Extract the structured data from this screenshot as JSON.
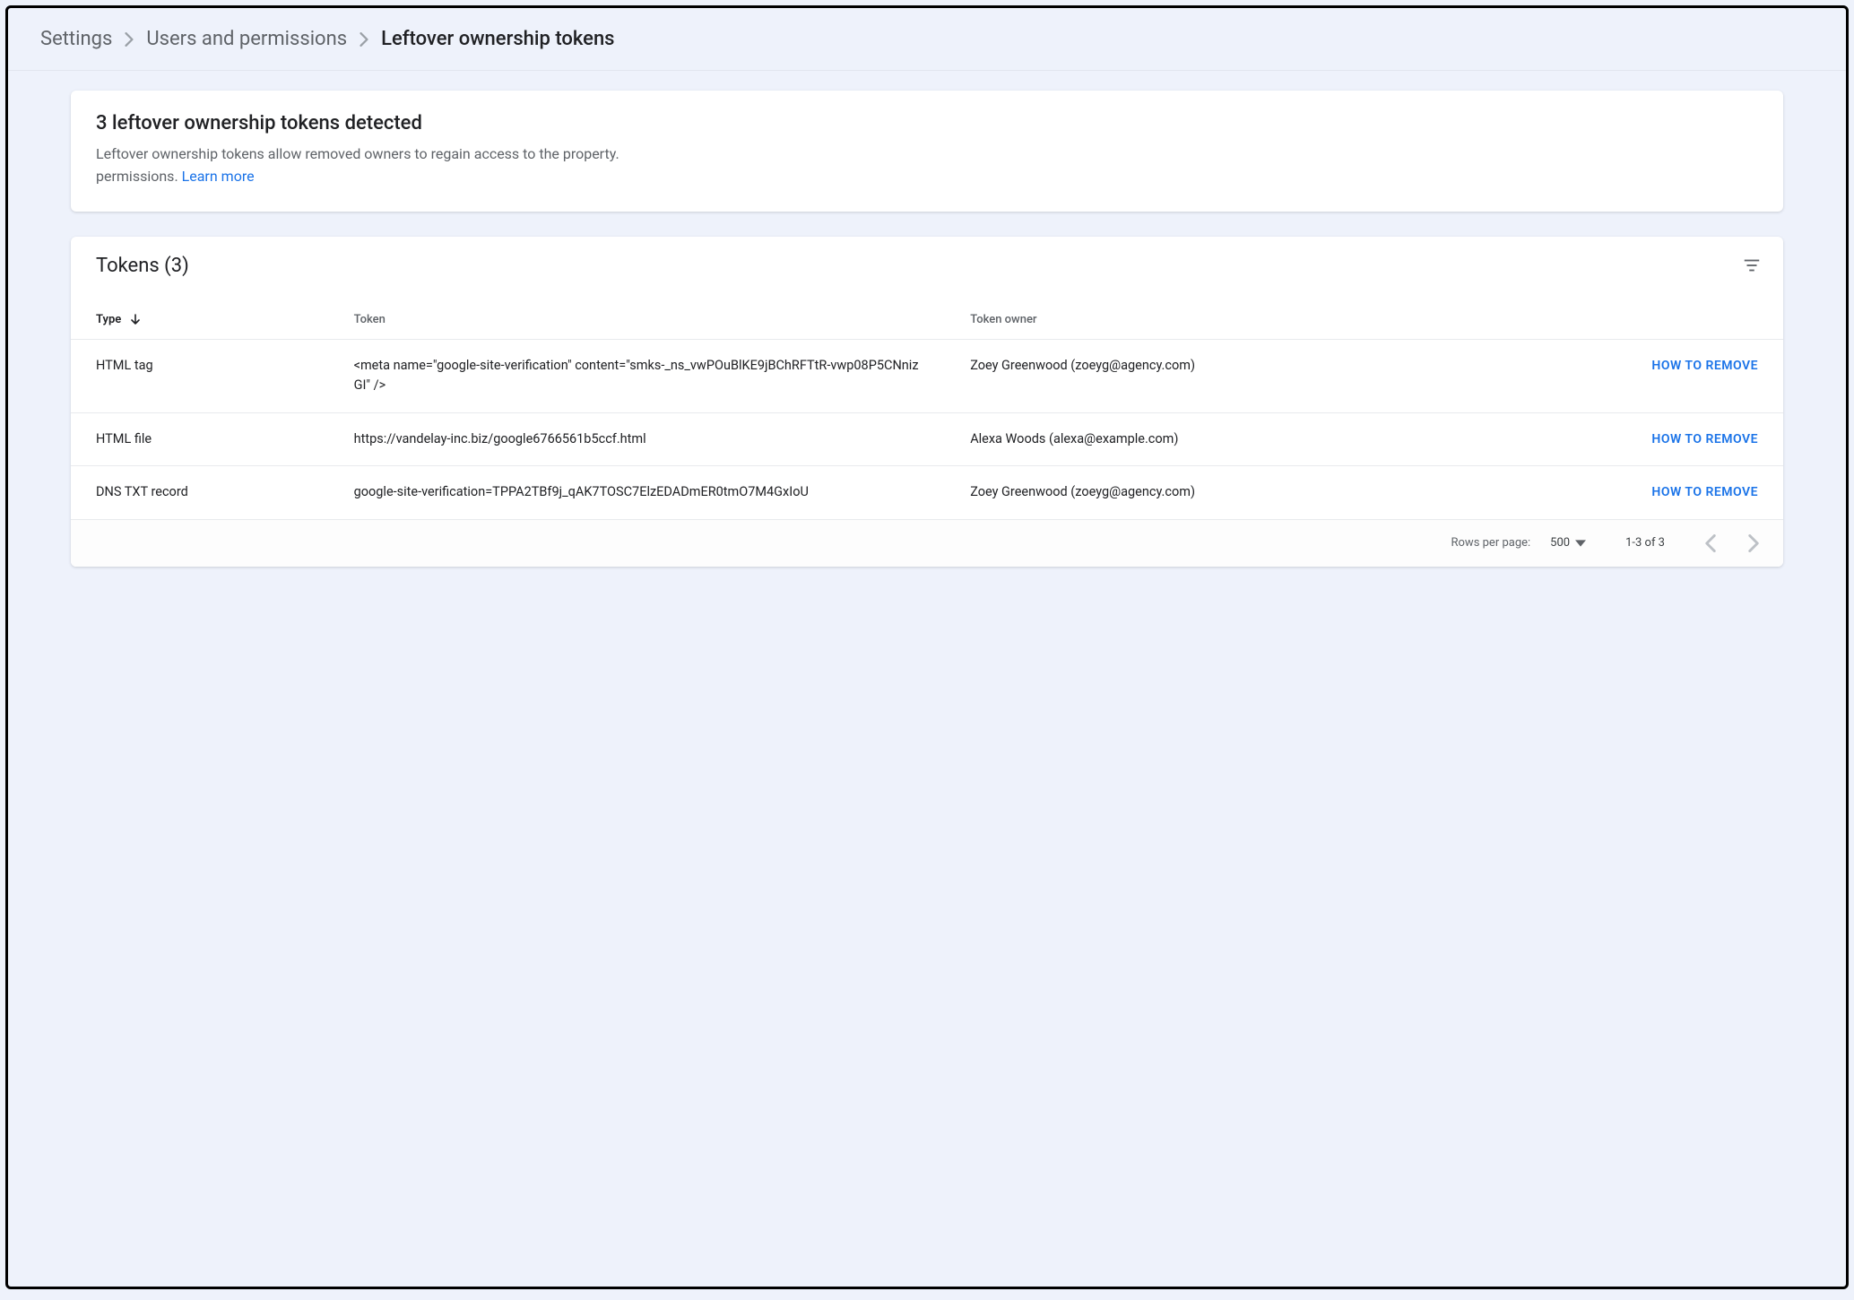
{
  "breadcrumb": {
    "items": [
      {
        "label": "Settings"
      },
      {
        "label": "Users and permissions"
      },
      {
        "label": "Leftover ownership tokens"
      }
    ]
  },
  "alert": {
    "title": "3 leftover ownership tokens detected",
    "body_line1": "Leftover ownership tokens allow removed owners to regain access to the property.",
    "body_line2_prefix": "permissions. ",
    "learn_more_label": "Learn more"
  },
  "table": {
    "title": "Tokens (3)",
    "columns": {
      "type": "Type",
      "token": "Token",
      "owner": "Token owner"
    },
    "action_label": "HOW TO REMOVE",
    "rows": [
      {
        "type": "HTML tag",
        "token": "<meta name=\"google-site-verification\" content=\"smks-_ns_vwPOuBlKE9jBChRFTtR-vwp08P5CNnizGI\" />",
        "owner": "Zoey Greenwood (zoeyg@agency.com)"
      },
      {
        "type": "HTML file",
        "token": "https://vandelay-inc.biz/google6766561b5ccf.html",
        "owner": "Alexa Woods (alexa@example.com)"
      },
      {
        "type": "DNS TXT record",
        "token": "google-site-verification=TPPA2TBf9j_qAK7TOSC7ElzEDADmER0tmO7M4GxIoU",
        "owner": "Zoey Greenwood (zoeyg@agency.com)"
      }
    ],
    "footer": {
      "rows_per_page_label": "Rows per page:",
      "rows_per_page_value": "500",
      "page_range": "1-3 of 3"
    }
  }
}
